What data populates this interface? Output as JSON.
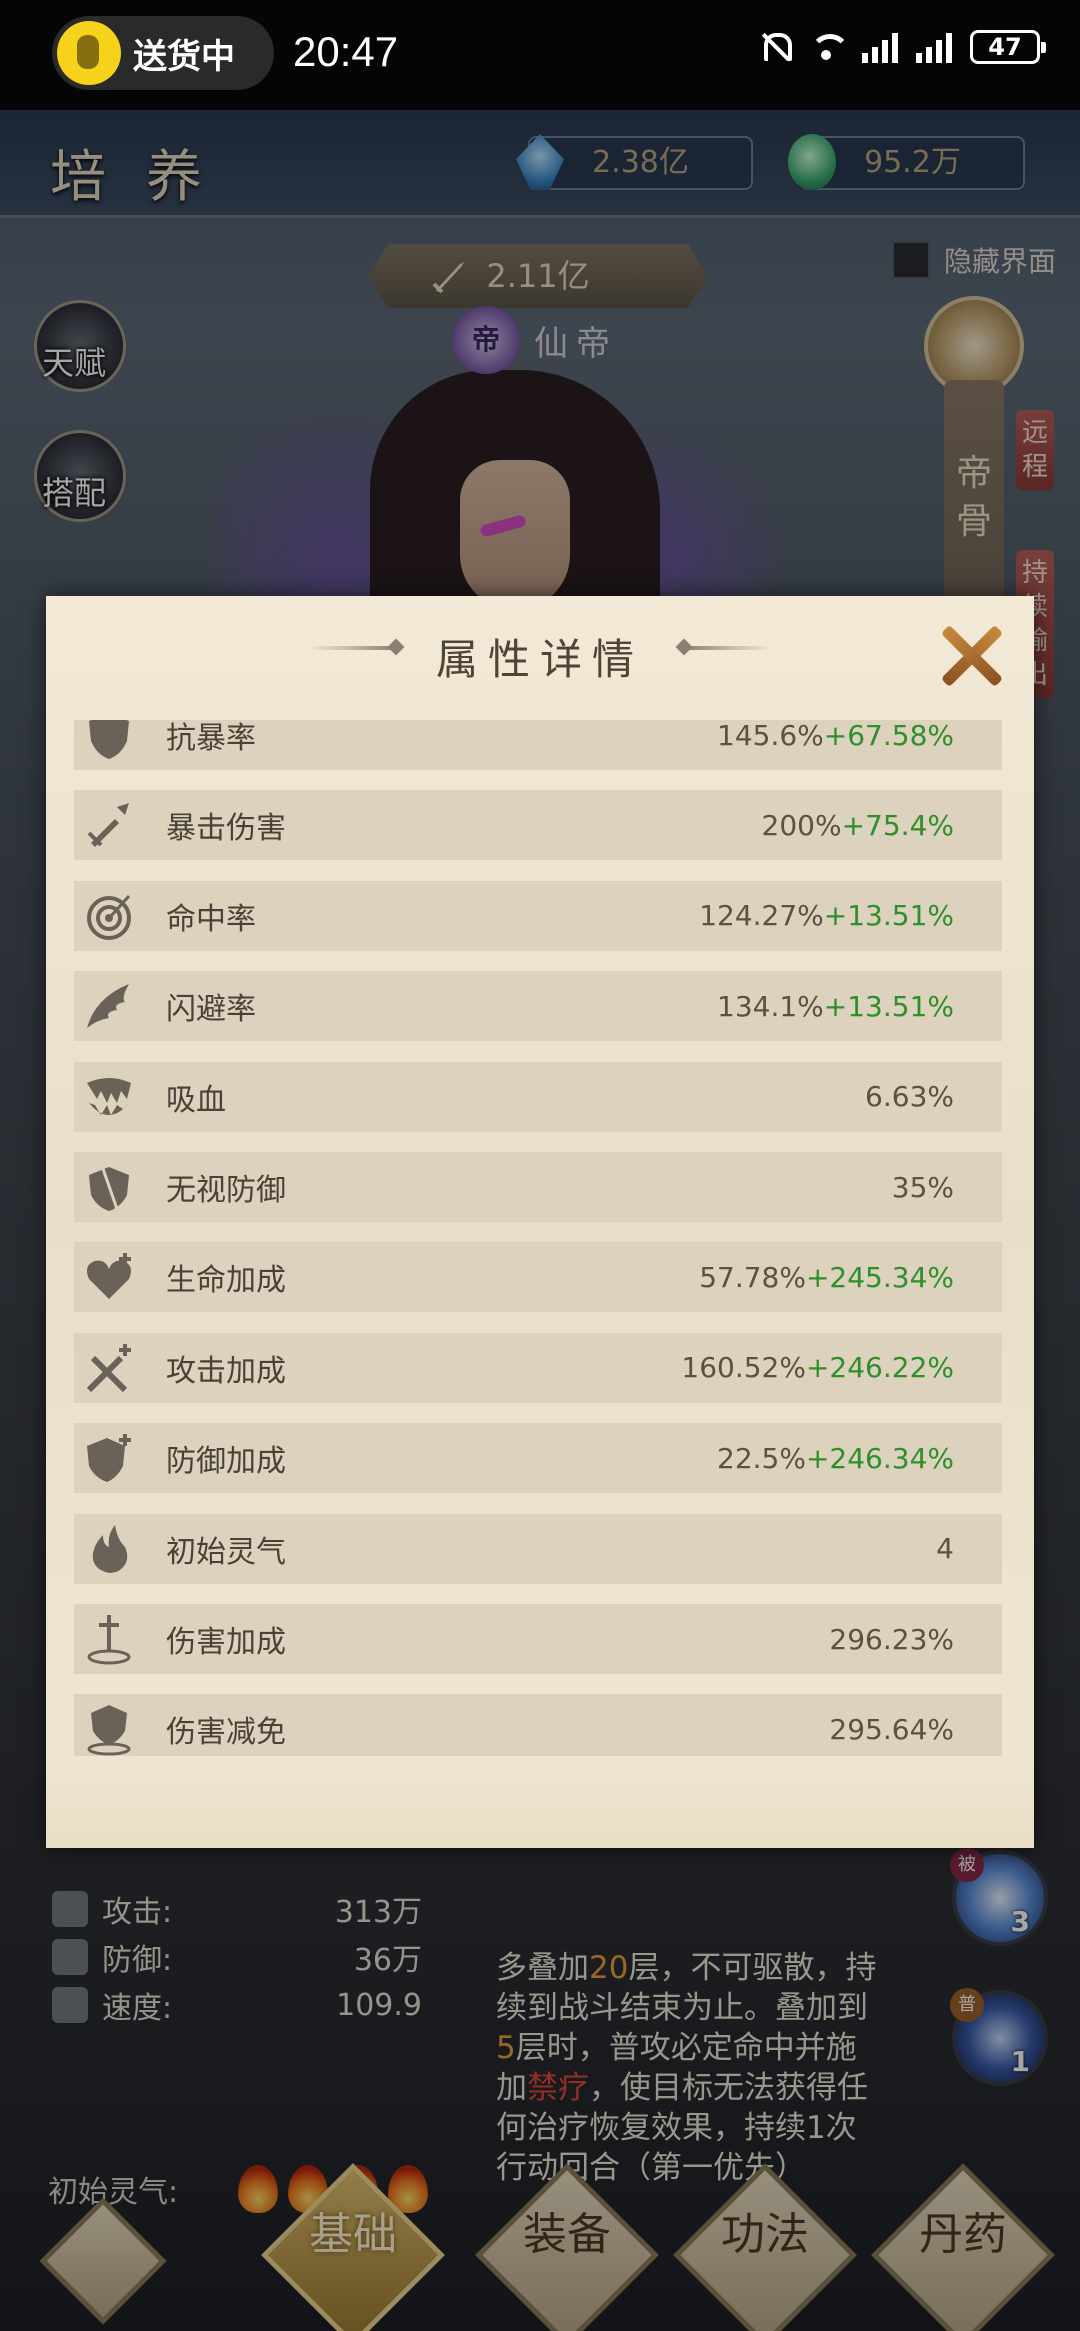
{
  "status_bar": {
    "delivery_label": "送货中",
    "time": "20:47",
    "battery": "47"
  },
  "header": {
    "title": "培养",
    "currency_1": "2.38亿",
    "currency_2": "95.2万"
  },
  "hero": {
    "power": "2.11亿",
    "rank_badge": "帝",
    "rank_name": "仙帝"
  },
  "hide_ui_label": "隐藏界面",
  "side_left": {
    "talent": "天赋",
    "pairing": "搭配"
  },
  "side_right": {
    "emperor_bone": "帝骨",
    "tag_ranged": "远程",
    "tag_sustain": "持续输出"
  },
  "modal": {
    "title": "属性详情",
    "rows": [
      {
        "name": "抗暴率",
        "base": "145.6%",
        "bonus": "+67.58%",
        "icon": "shield-icon"
      },
      {
        "name": "暴击伤害",
        "base": "200%",
        "bonus": "+75.4%",
        "icon": "broken-sword-icon"
      },
      {
        "name": "命中率",
        "base": "124.27%",
        "bonus": "+13.51%",
        "icon": "target-icon"
      },
      {
        "name": "闪避率",
        "base": "134.1%",
        "bonus": "+13.51%",
        "icon": "wing-icon"
      },
      {
        "name": "吸血",
        "base": "6.63%",
        "bonus": "",
        "icon": "fangs-icon"
      },
      {
        "name": "无视防御",
        "base": "35%",
        "bonus": "",
        "icon": "pierced-shield-icon"
      },
      {
        "name": "生命加成",
        "base": "57.78%",
        "bonus": "+245.34%",
        "icon": "heart-plus-icon"
      },
      {
        "name": "攻击加成",
        "base": "160.52%",
        "bonus": "+246.22%",
        "icon": "crossed-swords-plus-icon"
      },
      {
        "name": "防御加成",
        "base": "22.5%",
        "bonus": "+246.34%",
        "icon": "shield-plus-icon"
      },
      {
        "name": "初始灵气",
        "base": "4",
        "bonus": "",
        "icon": "flame-icon"
      },
      {
        "name": "伤害加成",
        "base": "296.23%",
        "bonus": "",
        "icon": "sword-ground-icon"
      },
      {
        "name": "伤害减免",
        "base": "295.64%",
        "bonus": "",
        "icon": "shield-ground-icon"
      }
    ]
  },
  "stats": {
    "attack_label": "攻击:",
    "attack_value": "313万",
    "defense_label": "防御:",
    "defense_value": "36万",
    "speed_label": "速度:",
    "speed_value": "109.9",
    "initial_qi_label": "初始灵气:"
  },
  "skill": {
    "l1a": "多叠加",
    "l1b": "20",
    "l1c": "层，不可驱散，持",
    "l2": "续到战斗结束为止。叠加到",
    "l3a": "5",
    "l3b": "层时，普攻必定命中并施",
    "l4a": "加",
    "l4b": "禁疗",
    "l4c": "，使目标无法获得任",
    "l5": "何治疗恢复效果，持续1次",
    "l6": "行动回合（第一优先）"
  },
  "skill_orbs": [
    {
      "tag": "被",
      "count": "3"
    },
    {
      "tag": "普",
      "count": "1"
    }
  ],
  "bottom_nav": {
    "basic": "基础",
    "equip": "装备",
    "technique": "功法",
    "pill": "丹药"
  }
}
